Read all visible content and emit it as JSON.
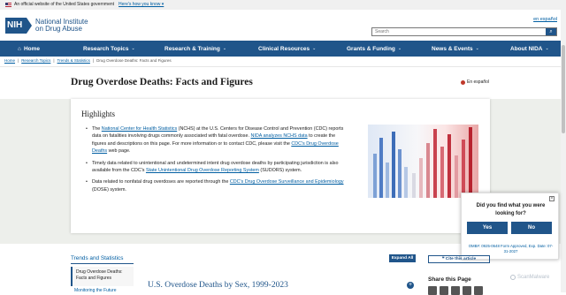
{
  "gov_banner": {
    "text": "An official website of the United States government",
    "link": "Here's how you know ▾"
  },
  "header": {
    "logo_badge": "NIH",
    "logo_name_line1": "National Institute",
    "logo_name_line2": "on Drug Abuse",
    "en_espanol": "en español",
    "search_placeholder": "Search"
  },
  "nav": {
    "items": [
      {
        "label": "Home"
      },
      {
        "label": "Research Topics"
      },
      {
        "label": "Research & Training"
      },
      {
        "label": "Clinical Resources"
      },
      {
        "label": "Grants & Funding"
      },
      {
        "label": "News & Events"
      },
      {
        "label": "About NIDA"
      }
    ]
  },
  "breadcrumb": [
    "Home",
    "Research Topics",
    "Trends & Statistics",
    "Drug Overdose Deaths: Facts and Figures"
  ],
  "page_title": "Drug Overdose Deaths: Facts and Figures",
  "espanol_link": "En español",
  "highlights": {
    "title": "Highlights",
    "b1_pre": "The ",
    "b1_link1": "National Center for Health Statistics",
    "b1_mid1": " (NCHS) at the U.S. Centers for Disease Control and Prevention (CDC) reports data on fatalities involving drugs commonly associated with fatal overdose. ",
    "b1_link2": "NIDA analyzes NCHS data",
    "b1_mid2": " to create the figures and descriptions on this page. For more information or to contact CDC, please visit the ",
    "b1_link3": "CDC's Drug Overdose Deaths",
    "b1_end": " web page.",
    "b2_pre": "Timely data related to unintentional and undetermined intent drug overdose deaths by participating jurisdiction is also available from the CDC's ",
    "b2_link": "State Unintentional Drug Overdose Reporting System",
    "b2_end": " (SUDORS) system.",
    "b3_pre": "Data related to nonfatal drug overdoses are reported through the ",
    "b3_link": "CDC's Drug Overdose Surveillance and Epidemiology",
    "b3_end": " (DOSE) system."
  },
  "survey": {
    "close": "×",
    "question": "Did you find what you were looking for?",
    "yes": "Yes",
    "no": "No",
    "omb": "OMB#: 0925-0648 Form Approved, Exp. Date: 07-31-2027"
  },
  "sidebar": {
    "title": "Trends and Statistics",
    "active_item": "Drug Overdose Deaths: Facts and Figures",
    "next_item": "Monitoring the Future"
  },
  "toolbar": {
    "expand_all": "Expand All",
    "cite": "❝ Cite this article"
  },
  "section": {
    "title": "U.S. Overdose Deaths by Sex, 1999-2023",
    "toggle": "+"
  },
  "share": {
    "title": "Share this Page"
  },
  "watermark": "ScanMalware"
}
